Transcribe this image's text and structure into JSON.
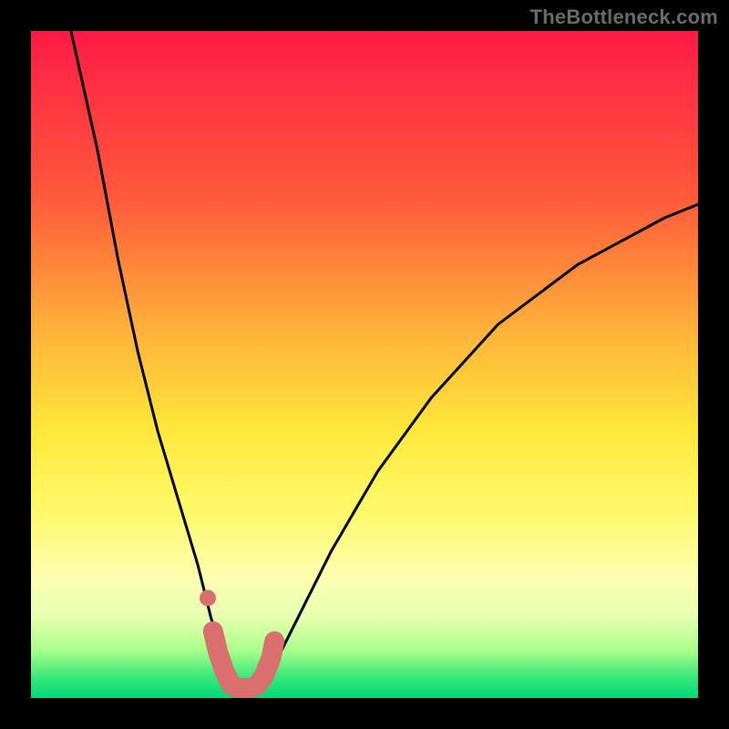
{
  "watermark": "TheBottleneck.com",
  "colors": {
    "frame": "#000000",
    "curve_stroke": "#000000",
    "marker_stroke": "#d96f6f",
    "marker_fill": "#d96f6f",
    "watermark": "#6b6b6b",
    "gradient_stops": [
      {
        "pct": 0,
        "hex": "#ff1a47"
      },
      {
        "pct": 25,
        "hex": "#ff5a3a"
      },
      {
        "pct": 45,
        "hex": "#ffb23a"
      },
      {
        "pct": 60,
        "hex": "#ffe83a"
      },
      {
        "pct": 72,
        "hex": "#fff96a"
      },
      {
        "pct": 82,
        "hex": "#fdffb0"
      },
      {
        "pct": 88,
        "hex": "#e6ffb0"
      },
      {
        "pct": 93,
        "hex": "#a6ff8a"
      },
      {
        "pct": 97,
        "hex": "#34e77a"
      },
      {
        "pct": 100,
        "hex": "#00d978"
      }
    ]
  },
  "chart_data": {
    "type": "line",
    "title": "",
    "xlabel": "",
    "ylabel": "",
    "xlim": [
      0,
      100
    ],
    "ylim": [
      0,
      100
    ],
    "grid": false,
    "series": [
      {
        "name": "bottleneck-curve",
        "x": [
          6,
          10,
          13,
          16,
          19,
          22,
          25,
          27,
          29,
          30,
          31,
          32,
          33,
          34,
          35,
          37,
          40,
          45,
          52,
          60,
          70,
          82,
          95,
          100
        ],
        "y": [
          100,
          82,
          66,
          52,
          40,
          30,
          20,
          12,
          6,
          3,
          2,
          1.5,
          1.5,
          2,
          3,
          6,
          12,
          22,
          34,
          45,
          56,
          65,
          72,
          74
        ]
      }
    ],
    "markers": {
      "name": "highlight-region",
      "style": "thick-rounded",
      "x": [
        27.3,
        28,
        29,
        30,
        31,
        32,
        33,
        34,
        35,
        36,
        36.5
      ],
      "y": [
        10,
        7,
        4,
        2,
        1.5,
        1.5,
        1.5,
        2,
        3.5,
        6,
        8.5
      ]
    },
    "lone_marker": {
      "x": 26.5,
      "y": 15
    }
  }
}
